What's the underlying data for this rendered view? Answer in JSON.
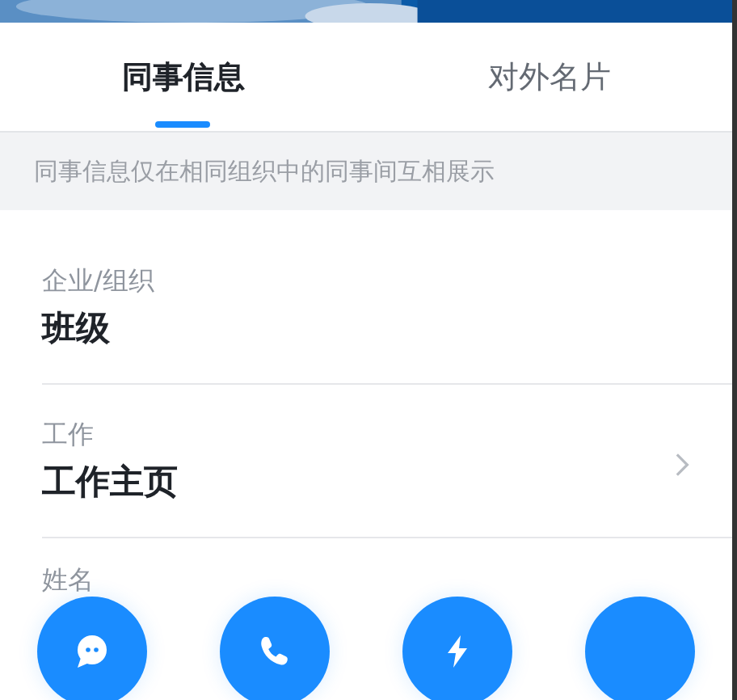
{
  "tabs": [
    {
      "label": "同事信息",
      "selected": true
    },
    {
      "label": "对外名片",
      "selected": false
    }
  ],
  "notice": "同事信息仅在相同组织中的同事间互相展示",
  "fields": [
    {
      "label": "企业/组织",
      "value": "班级",
      "has_chevron": false
    },
    {
      "label": "工作",
      "value": "工作主页",
      "has_chevron": true
    },
    {
      "label": "姓名"
    }
  ],
  "actions": [
    {
      "kind": "chat"
    },
    {
      "kind": "call"
    },
    {
      "kind": "flash"
    },
    {
      "kind": "other"
    }
  ]
}
